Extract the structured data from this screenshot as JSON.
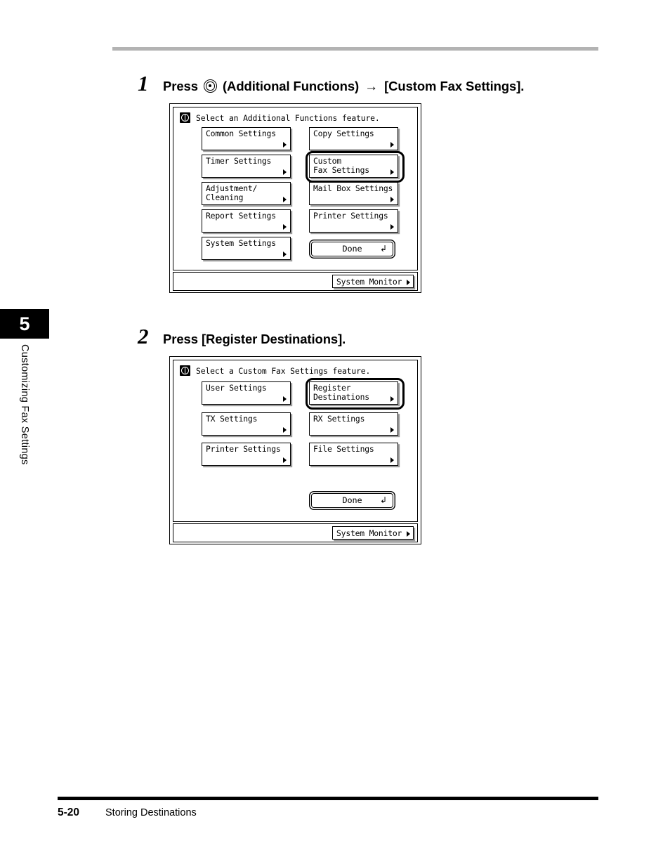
{
  "page": {
    "chapter_number": "5",
    "chapter_title": "Customizing Fax Settings",
    "footer_page_number": "5-20",
    "footer_section_title": "Storing Destinations"
  },
  "steps": [
    {
      "number": "1",
      "text_before_icon": "Press",
      "icon": "additional-functions-icon",
      "text_after_icon": "(Additional Functions)",
      "arrow": "→",
      "text_target": "[Custom Fax Settings]."
    },
    {
      "number": "2",
      "text": "Press [Register Destinations]."
    }
  ],
  "panels": [
    {
      "id": "additional-functions-screen",
      "title_icon": "additional-functions-badge-icon",
      "title": "Select an Additional Functions feature.",
      "buttons": [
        {
          "label": "Common Settings",
          "selected": false,
          "arrow": "right-triangle-icon"
        },
        {
          "label": "Copy Settings",
          "selected": false,
          "arrow": "right-triangle-icon"
        },
        {
          "label": "Timer Settings",
          "selected": false,
          "arrow": "right-triangle-icon"
        },
        {
          "label": "Custom\nFax Settings",
          "selected": true,
          "arrow": "right-triangle-icon"
        },
        {
          "label": "Adjustment/\nCleaning",
          "selected": false,
          "arrow": "right-triangle-icon"
        },
        {
          "label": "Mail Box Settings",
          "selected": false,
          "arrow": "right-triangle-icon"
        },
        {
          "label": "Report Settings",
          "selected": false,
          "arrow": "right-triangle-icon"
        },
        {
          "label": "Printer Settings",
          "selected": false,
          "arrow": "right-triangle-icon"
        },
        {
          "label": "System Settings",
          "selected": false,
          "arrow": "right-triangle-icon"
        }
      ],
      "done_label": "Done",
      "done_glyph": "↲",
      "system_monitor_label": "System Monitor"
    },
    {
      "id": "custom-fax-settings-screen",
      "title_icon": "additional-functions-badge-icon",
      "title": "Select a Custom Fax Settings feature.",
      "buttons": [
        {
          "label": "User Settings",
          "selected": false,
          "arrow": "right-triangle-icon"
        },
        {
          "label": "Register\nDestinations",
          "selected": true,
          "arrow": "right-triangle-icon"
        },
        {
          "label": "TX Settings",
          "selected": false,
          "arrow": "right-triangle-icon"
        },
        {
          "label": "RX Settings",
          "selected": false,
          "arrow": "right-triangle-icon"
        },
        {
          "label": "Printer Settings",
          "selected": false,
          "arrow": "right-triangle-icon"
        },
        {
          "label": "File Settings",
          "selected": false,
          "arrow": "right-triangle-icon"
        }
      ],
      "done_label": "Done",
      "done_glyph": "↲",
      "system_monitor_label": "System Monitor"
    }
  ],
  "colors": {
    "rule_gray": "#b3b3b3",
    "button_shadow": "#9a9a9a",
    "ink": "#000000",
    "paper": "#ffffff"
  }
}
